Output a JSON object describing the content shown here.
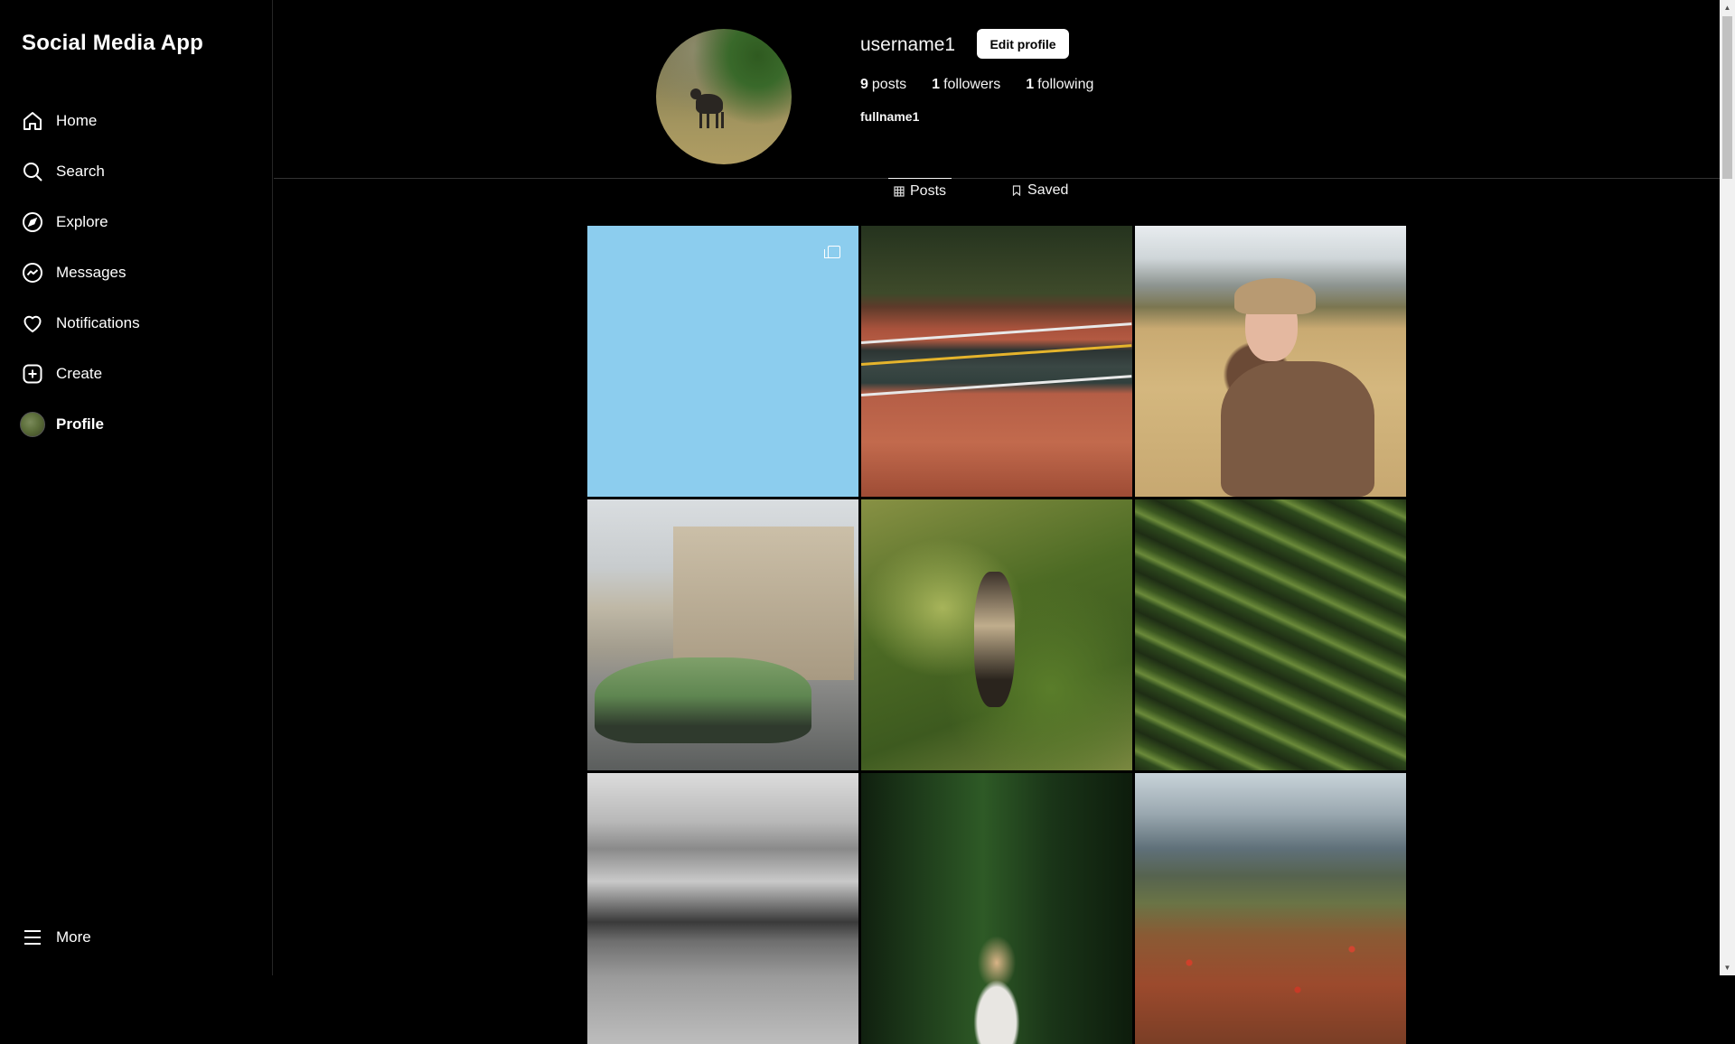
{
  "app": {
    "title": "Social Media App"
  },
  "sidebar": {
    "items": [
      {
        "label": "Home",
        "icon": "home-icon"
      },
      {
        "label": "Search",
        "icon": "search-icon"
      },
      {
        "label": "Explore",
        "icon": "compass-icon"
      },
      {
        "label": "Messages",
        "icon": "messenger-icon"
      },
      {
        "label": "Notifications",
        "icon": "heart-icon"
      },
      {
        "label": "Create",
        "icon": "plus-square-icon"
      },
      {
        "label": "Profile",
        "icon": "avatar",
        "active": true
      }
    ],
    "more": {
      "label": "More",
      "icon": "menu-icon"
    }
  },
  "profile": {
    "username": "username1",
    "edit_button": "Edit profile",
    "stats": {
      "posts_count": "9",
      "posts_label": "posts",
      "followers_count": "1",
      "followers_label": "followers",
      "following_count": "1",
      "following_label": "following"
    },
    "fullname": "fullname1"
  },
  "tabs": [
    {
      "label": "Posts",
      "icon": "grid-icon",
      "active": true
    },
    {
      "label": "Saved",
      "icon": "bookmark-icon",
      "active": false
    }
  ],
  "posts": [
    {
      "type": "carousel",
      "color": "#8ccdee"
    },
    {
      "type": "photo",
      "subject": "road"
    },
    {
      "type": "photo",
      "subject": "woman"
    },
    {
      "type": "photo",
      "subject": "car"
    },
    {
      "type": "photo",
      "subject": "monkey"
    },
    {
      "type": "photo",
      "subject": "terraces"
    },
    {
      "type": "photo",
      "subject": "lake"
    },
    {
      "type": "photo",
      "subject": "forest"
    },
    {
      "type": "photo",
      "subject": "poppies"
    }
  ],
  "colors": {
    "background": "#000000",
    "text": "#f5f5f5",
    "button_bg": "#ffffff",
    "divider": "#333333"
  }
}
